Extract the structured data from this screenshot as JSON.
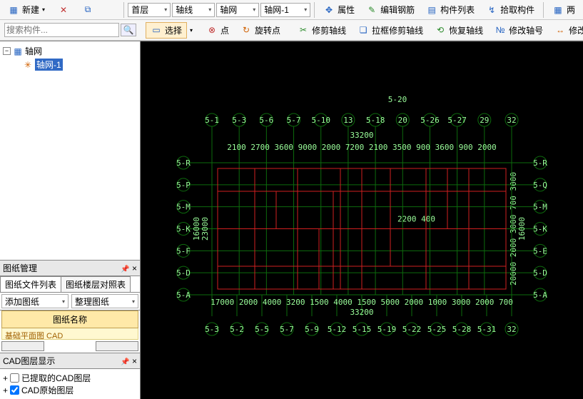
{
  "left": {
    "new_btn": "新建",
    "search_placeholder": "搜索构件...",
    "tree_root": "轴网",
    "tree_item": "轴网-1",
    "drawing_mgr": "图纸管理",
    "tab_files": "图纸文件列表",
    "tab_compare": "图纸楼层对照表",
    "add_drawing": "添加图纸",
    "arrange_drawing": "整理图纸",
    "col_name": "图纸名称",
    "row1": "基础平面图  CAD",
    "cad_layer_disp": "CAD图层显示",
    "cad_extracted": "已提取的CAD图层",
    "cad_original": "CAD原始图层"
  },
  "top1": {
    "floor_label": "首层",
    "axis_label": "轴线",
    "grid_label": "轴网",
    "grid1_label": "轴网-1",
    "attr": "属性",
    "edit_rebar": "编辑钢筋",
    "comp_list": "构件列表",
    "pick_comp": "拾取构件",
    "two": "两"
  },
  "top2": {
    "select": "选择",
    "point": "点",
    "rot_point": "旋转点",
    "trim_axis": "修剪轴线",
    "box_trim": "拉框修剪轴线",
    "restore_axis": "恢复轴线",
    "mod_axis_no": "修改轴号",
    "mod_axis_dist": "修改轴距"
  },
  "cad": {
    "top_label": "5-20",
    "row1_labels": [
      "5-1",
      "5-3",
      "5-6",
      "5-7",
      "5-10",
      "13",
      "5-18",
      "20",
      "5-26",
      "5-27",
      "29",
      "32"
    ],
    "row2_text": "33200",
    "row3_text": "2100 2700 3600 9000 2000  7200  2100 3500 900 3600 900 2000",
    "left_axes": [
      "5-R",
      "5-P",
      "5-M",
      "5-K",
      "5-F",
      "5-D",
      "5-A"
    ],
    "right_axes": [
      "5-R",
      "5-Q",
      "5-M",
      "5-K",
      "5-E",
      "5-D",
      "5-A"
    ],
    "l_dim1": "16000",
    "l_dim2": "23000",
    "mid_dim": "2200 400",
    "bot_text": "17000 2000 4000 3200 1500 4000 1500 5000 2000 1000 3000 2000 700",
    "bot_total": "33200",
    "bot_labels": [
      "5-3",
      "5-2",
      "5-5",
      "5-7",
      "5-9",
      "5-12",
      "5-15",
      "5-19",
      "5-22",
      "5-25",
      "5-28",
      "5-31",
      "32"
    ],
    "r_dim1": "16000",
    "r_dim2": "20000 2000 3000 700 3000"
  }
}
